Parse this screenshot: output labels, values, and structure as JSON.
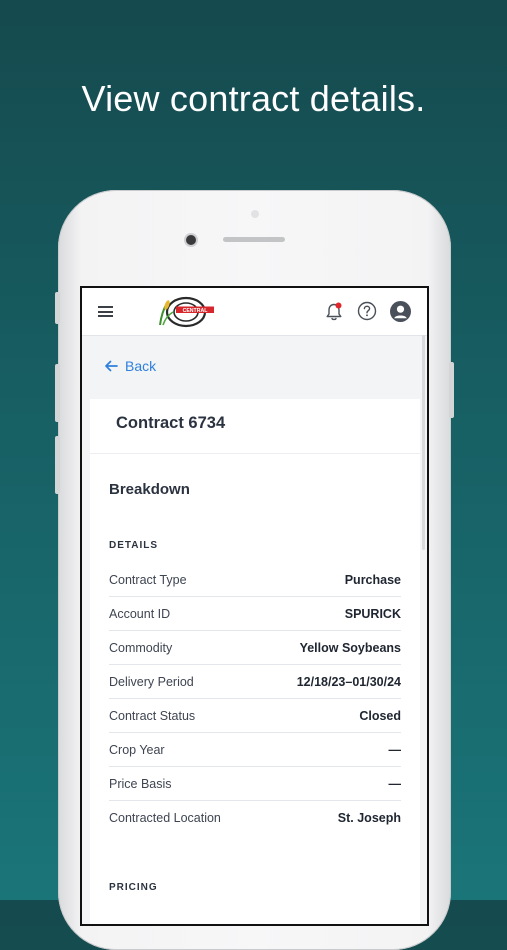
{
  "headline": "View contract details.",
  "app": {
    "notification_dot_color": "#e0262b",
    "accent_color": "#2f7fdc",
    "logo_text": "CENTRAL"
  },
  "nav": {
    "back_label": "Back"
  },
  "contract": {
    "title": "Contract 6734",
    "breakdown_heading": "Breakdown",
    "details_label": "DETAILS",
    "details": [
      {
        "label": "Contract Type",
        "value": "Purchase"
      },
      {
        "label": "Account ID",
        "value": "SPURICK"
      },
      {
        "label": "Commodity",
        "value": "Yellow Soybeans"
      },
      {
        "label": "Delivery Period",
        "value": "12/18/23–01/30/24"
      },
      {
        "label": "Contract Status",
        "value": "Closed"
      },
      {
        "label": "Crop Year",
        "value": "—"
      },
      {
        "label": "Price Basis",
        "value": "—"
      },
      {
        "label": "Contracted Location",
        "value": "St. Joseph"
      }
    ],
    "pricing_label": "PRICING"
  }
}
